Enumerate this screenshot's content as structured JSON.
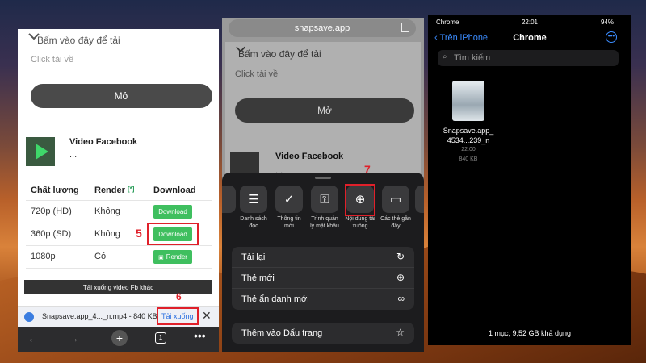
{
  "panel1": {
    "top_text": "Bấm vào đây để tải",
    "click_text": "Click tải về",
    "open_label": "Mở",
    "video_title": "Video Facebook",
    "video_sub": "...",
    "col_quality": "Chất lượng",
    "col_render": "Render",
    "col_render_sup": "[*]",
    "col_download": "Download",
    "rows": [
      {
        "quality": "720p (HD)",
        "render": "Không",
        "action": "Download"
      },
      {
        "quality": "360p (SD)",
        "render": "Không",
        "action": "Download"
      },
      {
        "quality": "1080p",
        "render": "Có",
        "action": "Render"
      }
    ],
    "other_video": "Tải xuống video Fb khác",
    "download_name": "Snapsave.app_4..._n.mp4 - 840 KB",
    "download_link": "Tải xuống",
    "close_glyph": "✕",
    "step5": "5",
    "step6": "6",
    "tab_count": "1"
  },
  "panel2": {
    "url": "snapsave.app",
    "top_text": "Bấm vào đây để tải",
    "click_text": "Click tải về",
    "open_label": "Mở",
    "video_title": "Video Facebook",
    "video_sub": "...",
    "step7": "7",
    "actions": [
      {
        "label": "",
        "icon": "partial-icon"
      },
      {
        "label": "Danh sách đọc",
        "icon": "reading-list-icon"
      },
      {
        "label": "Thông tin mới",
        "icon": "badge-icon"
      },
      {
        "label": "Trình quản lý mật khẩu",
        "icon": "key-icon"
      },
      {
        "label": "Nội dung tải xuống",
        "icon": "download-icon"
      },
      {
        "label": "Các thẻ gần đây",
        "icon": "devices-icon"
      },
      {
        "label": "Th",
        "icon": "partial-icon"
      }
    ],
    "menu": [
      {
        "label": "Tải lại",
        "icon": "reload-icon"
      },
      {
        "label": "Thẻ mới",
        "icon": "plus-circle-icon"
      },
      {
        "label": "Thẻ ẩn danh mới",
        "icon": "incognito-icon"
      }
    ],
    "menu2": [
      {
        "label": "Thêm vào Dấu trang",
        "icon": "star-icon"
      }
    ]
  },
  "panel3": {
    "carrier": "Chrome",
    "time": "22:01",
    "battery": "94%",
    "back_label": "Trên iPhone",
    "title": "Chrome",
    "search_placeholder": "Tìm kiếm",
    "file_name_1": "Snapsave.app_",
    "file_name_2": "4534...239_n",
    "file_time": "22:00",
    "file_size": "840 KB",
    "footer": "1 mục, 9,52 GB khả dụng"
  },
  "colors": {
    "accent_green": "#3fbf5f",
    "highlight_red": "#e0202a",
    "ios_blue": "#3b8cff"
  }
}
